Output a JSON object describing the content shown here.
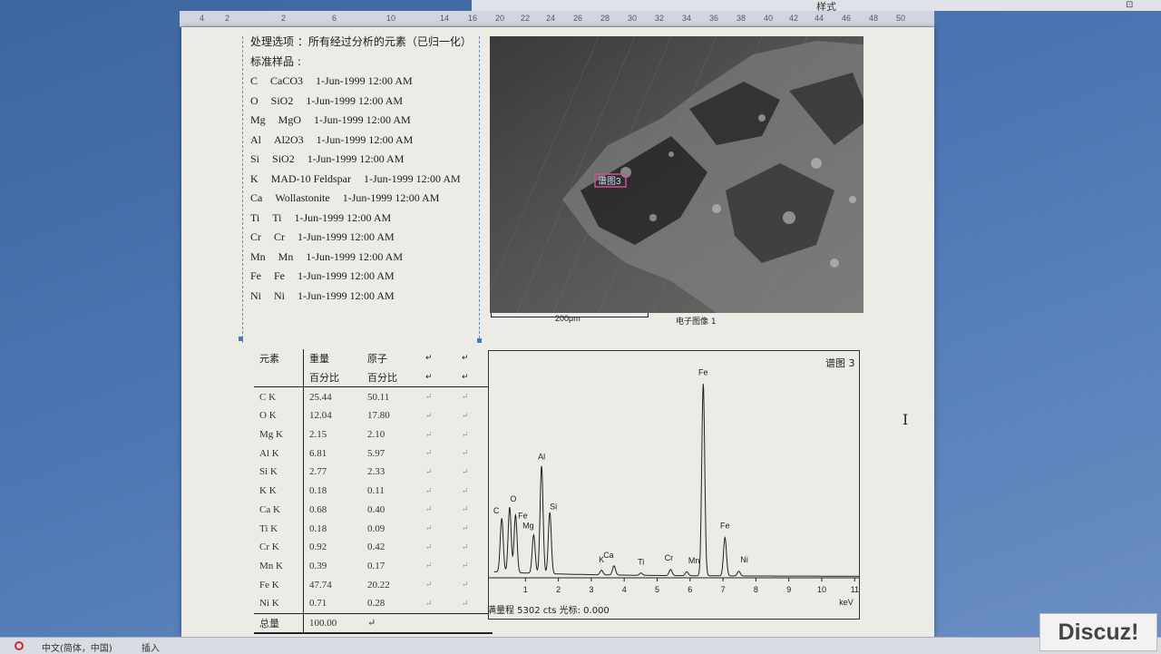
{
  "ruler": {
    "ticks": [
      "4",
      "2",
      "2",
      "6",
      "10",
      "14",
      "16",
      "20",
      "22",
      "24",
      "26",
      "28",
      "30",
      "32",
      "34",
      "36",
      "38",
      "40",
      "42",
      "44",
      "46",
      "48",
      "50"
    ]
  },
  "ribbon": {
    "style_label": "样式",
    "expand": "⊡"
  },
  "document": {
    "processing_line": "处理选项 ：所有经过分析的元素（已归一化）",
    "standards_heading": "标准样品 :",
    "standards": [
      {
        "el": "C",
        "std": "CaCO3",
        "date": "1-Jun-1999 12:00 AM"
      },
      {
        "el": "O",
        "std": "SiO2",
        "date": "1-Jun-1999 12:00 AM"
      },
      {
        "el": "Mg",
        "std": "MgO",
        "date": "1-Jun-1999 12:00 AM"
      },
      {
        "el": "Al",
        "std": "Al2O3",
        "date": "1-Jun-1999 12:00 AM"
      },
      {
        "el": "Si",
        "std": "SiO2",
        "date": "1-Jun-1999 12:00 AM"
      },
      {
        "el": "K",
        "std": "MAD-10 Feldspar",
        "date": "1-Jun-1999 12:00 AM"
      },
      {
        "el": "Ca",
        "std": "Wollastonite",
        "date": "1-Jun-1999 12:00 AM"
      },
      {
        "el": "Ti",
        "std": "Ti",
        "date": "1-Jun-1999 12:00 AM"
      },
      {
        "el": "Cr",
        "std": "Cr",
        "date": "1-Jun-1999 12:00 AM"
      },
      {
        "el": "Mn",
        "std": "Mn",
        "date": "1-Jun-1999 12:00 AM"
      },
      {
        "el": "Fe",
        "std": "Fe",
        "date": "1-Jun-1999 12:00 AM"
      },
      {
        "el": "Ni",
        "std": "Ni",
        "date": "1-Jun-1999 12:00 AM"
      }
    ]
  },
  "composition_table": {
    "header_row1": [
      "元素",
      "重量",
      "原子"
    ],
    "header_row2": [
      "",
      "百分比",
      "百分比"
    ],
    "rows": [
      [
        "C K",
        "25.44",
        "50.11"
      ],
      [
        "O K",
        "12.04",
        "17.80"
      ],
      [
        "Mg K",
        "2.15",
        "2.10"
      ],
      [
        "Al K",
        "6.81",
        "5.97"
      ],
      [
        "Si K",
        "2.77",
        "2.33"
      ],
      [
        "K K",
        "0.18",
        "0.11"
      ],
      [
        "Ca K",
        "0.68",
        "0.40"
      ],
      [
        "Ti K",
        "0.18",
        "0.09"
      ],
      [
        "Cr K",
        "0.92",
        "0.42"
      ],
      [
        "Mn K",
        "0.39",
        "0.17"
      ],
      [
        "Fe K",
        "47.74",
        "20.22"
      ],
      [
        "Ni K",
        "0.71",
        "0.28"
      ]
    ],
    "total": [
      "总量",
      "100.00"
    ]
  },
  "sem_image": {
    "scale": "200μm",
    "caption": "电子图像 1",
    "spectrum_marker": "谱图3"
  },
  "spectrum": {
    "title": "谱图 3",
    "footer": "满量程 5302 cts 光标: 0.000",
    "x_unit": "keV",
    "x_ticks": [
      "1",
      "2",
      "3",
      "4",
      "5",
      "6",
      "7",
      "8",
      "9",
      "10",
      "11"
    ],
    "peaks": [
      {
        "label": "C",
        "kev": 0.28
      },
      {
        "label": "O",
        "kev": 0.52
      },
      {
        "label": "Fe",
        "kev": 0.7
      },
      {
        "label": "Mg",
        "kev": 1.25
      },
      {
        "label": "Al",
        "kev": 1.49
      },
      {
        "label": "Si",
        "kev": 1.74
      },
      {
        "label": "K",
        "kev": 3.31
      },
      {
        "label": "Ca",
        "kev": 3.69
      },
      {
        "label": "Ti",
        "kev": 4.51
      },
      {
        "label": "Cr",
        "kev": 5.41
      },
      {
        "label": "Mn",
        "kev": 5.9
      },
      {
        "label": "Fe",
        "kev": 6.4
      },
      {
        "label": "Fe",
        "kev": 7.06
      },
      {
        "label": "Ni",
        "kev": 7.48
      }
    ]
  },
  "statusbar": {
    "ime": "中文(简体，中国)",
    "mode": "插入"
  },
  "watermark": "Discuz!"
}
